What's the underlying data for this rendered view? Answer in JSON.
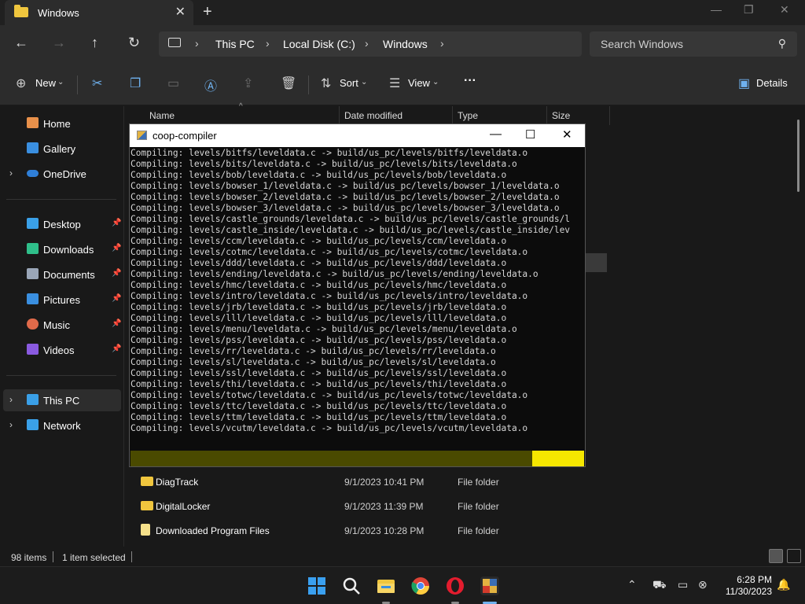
{
  "window": {
    "tab_title": "Windows",
    "close_symbol": "✕",
    "new_tab_symbol": "+"
  },
  "nav": {
    "back": "←",
    "forward": "→",
    "up": "↑",
    "refresh": "↻",
    "breadcrumbs": [
      "This PC",
      "Local Disk (C:)",
      "Windows"
    ],
    "chevron": "›",
    "search_placeholder": "Search Windows"
  },
  "toolbar": {
    "new_label": "New",
    "sort_label": "Sort",
    "view_label": "View",
    "more_label": "···",
    "details_label": "Details"
  },
  "sidebar": {
    "items": [
      {
        "label": "Home",
        "icon": "home-icon",
        "color": "#e8904a"
      },
      {
        "label": "Gallery",
        "icon": "gallery-icon",
        "color": "#3a8fe0"
      },
      {
        "label": "OneDrive",
        "icon": "onedrive-icon",
        "color": "#2f7fd8"
      },
      {
        "label": "Desktop",
        "icon": "desktop-icon",
        "color": "#3aa0e8"
      },
      {
        "label": "Downloads",
        "icon": "downloads-icon",
        "color": "#2fbf8a"
      },
      {
        "label": "Documents",
        "icon": "documents-icon",
        "color": "#9aa6b8"
      },
      {
        "label": "Pictures",
        "icon": "pictures-icon",
        "color": "#3a8fe0"
      },
      {
        "label": "Music",
        "icon": "music-icon",
        "color": "#e06a4a"
      },
      {
        "label": "Videos",
        "icon": "videos-icon",
        "color": "#8a5ae0"
      },
      {
        "label": "This PC",
        "icon": "this-pc-icon",
        "color": "#3aa0e8"
      },
      {
        "label": "Network",
        "icon": "network-icon",
        "color": "#3aa0e8"
      }
    ]
  },
  "columns": {
    "name": "Name",
    "date": "Date modified",
    "type": "Type",
    "size": "Size"
  },
  "files": [
    {
      "name": "DiagTrack",
      "date": "9/1/2023 10:41 PM",
      "type": "File folder"
    },
    {
      "name": "DigitalLocker",
      "date": "9/1/2023 11:39 PM",
      "type": "File folder"
    },
    {
      "name": "Downloaded Program Files",
      "date": "9/1/2023 10:28 PM",
      "type": "File folder"
    }
  ],
  "status": {
    "items": "98 items",
    "selected": "1 item selected"
  },
  "console": {
    "title": "coop-compiler",
    "minimize": "—",
    "maximize": "☐",
    "close": "✕",
    "lines": [
      "Compiling: levels/bitfs/leveldata.c -> build/us_pc/levels/bitfs/leveldata.o",
      "Compiling: levels/bits/leveldata.c -> build/us_pc/levels/bits/leveldata.o",
      "Compiling: levels/bob/leveldata.c -> build/us_pc/levels/bob/leveldata.o",
      "Compiling: levels/bowser_1/leveldata.c -> build/us_pc/levels/bowser_1/leveldata.o",
      "Compiling: levels/bowser_2/leveldata.c -> build/us_pc/levels/bowser_2/leveldata.o",
      "Compiling: levels/bowser_3/leveldata.c -> build/us_pc/levels/bowser_3/leveldata.o",
      "Compiling: levels/castle_grounds/leveldata.c -> build/us_pc/levels/castle_grounds/l",
      "Compiling: levels/castle_inside/leveldata.c -> build/us_pc/levels/castle_inside/lev",
      "Compiling: levels/ccm/leveldata.c -> build/us_pc/levels/ccm/leveldata.o",
      "Compiling: levels/cotmc/leveldata.c -> build/us_pc/levels/cotmc/leveldata.o",
      "Compiling: levels/ddd/leveldata.c -> build/us_pc/levels/ddd/leveldata.o",
      "Compiling: levels/ending/leveldata.c -> build/us_pc/levels/ending/leveldata.o",
      "Compiling: levels/hmc/leveldata.c -> build/us_pc/levels/hmc/leveldata.o",
      "Compiling: levels/intro/leveldata.c -> build/us_pc/levels/intro/leveldata.o",
      "Compiling: levels/jrb/leveldata.c -> build/us_pc/levels/jrb/leveldata.o",
      "Compiling: levels/lll/leveldata.c -> build/us_pc/levels/lll/leveldata.o",
      "Compiling: levels/menu/leveldata.c -> build/us_pc/levels/menu/leveldata.o",
      "Compiling: levels/pss/leveldata.c -> build/us_pc/levels/pss/leveldata.o",
      "Compiling: levels/rr/leveldata.c -> build/us_pc/levels/rr/leveldata.o",
      "Compiling: levels/sl/leveldata.c -> build/us_pc/levels/sl/leveldata.o",
      "Compiling: levels/ssl/leveldata.c -> build/us_pc/levels/ssl/leveldata.o",
      "Compiling: levels/thi/leveldata.c -> build/us_pc/levels/thi/leveldata.o",
      "Compiling: levels/totwc/leveldata.c -> build/us_pc/levels/totwc/leveldata.o",
      "Compiling: levels/ttc/leveldata.c -> build/us_pc/levels/ttc/leveldata.o",
      "Compiling: levels/ttm/leveldata.c -> build/us_pc/levels/ttm/leveldata.o",
      "Compiling: levels/vcutm/leveldata.c -> build/us_pc/levels/vcutm/leveldata.o"
    ],
    "progress_bar_color": "#f6e700",
    "progress_track_color": "#4a4a00"
  },
  "taskbar": {
    "time": "6:28 PM",
    "date": "11/30/2023",
    "apps": [
      "start-icon",
      "search-icon",
      "file-explorer-icon",
      "chrome-icon",
      "opera-icon",
      "coop-compiler-icon"
    ]
  }
}
